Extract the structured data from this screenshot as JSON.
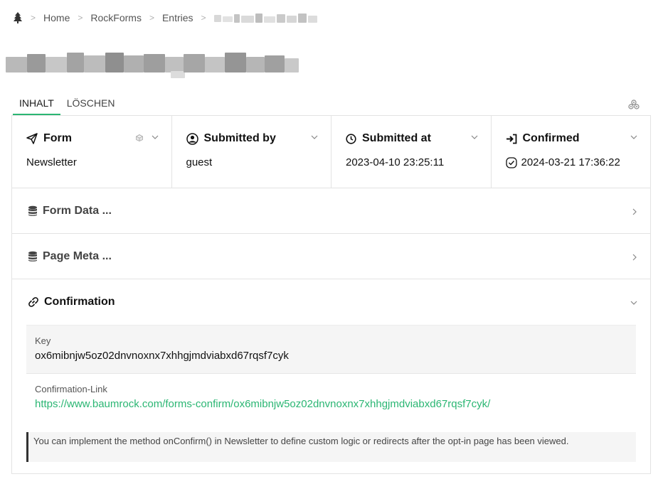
{
  "breadcrumb": {
    "items": [
      "Home",
      "RockForms",
      "Entries"
    ]
  },
  "tabs": [
    {
      "label": "INHALT",
      "active": true
    },
    {
      "label": "LÖSCHEN",
      "active": false
    }
  ],
  "summary": {
    "form": {
      "title": "Form",
      "value": "Newsletter"
    },
    "submitted_by": {
      "title": "Submitted by",
      "value": "guest"
    },
    "submitted_at": {
      "title": "Submitted at",
      "value": "2023-04-10 23:25:11"
    },
    "confirmed": {
      "title": "Confirmed",
      "value": "2024-03-21 17:36:22"
    }
  },
  "sections": {
    "form_data": {
      "title": "Form Data ..."
    },
    "page_meta": {
      "title": "Page Meta ..."
    },
    "confirmation": {
      "title": "Confirmation"
    }
  },
  "confirmation": {
    "key_label": "Key",
    "key_value": "ox6mibnjw5oz02dnvnoxnx7xhhgjmdviabxd67rqsf7cyk",
    "link_label": "Confirmation-Link",
    "link_value": "https://www.baumrock.com/forms-confirm/ox6mibnjw5oz02dnvnoxnx7xhhgjmdviabxd67rqsf7cyk/",
    "note": "You can implement the method onConfirm() in Newsletter to define custom logic or redirects after the opt-in page has been viewed."
  },
  "colors": {
    "accent": "#2bb673",
    "border": "#e3e3e3"
  },
  "icons": [
    "tree-icon",
    "settings-icon",
    "paper-plane-icon",
    "user-circle-icon",
    "clock-icon",
    "sign-in-icon",
    "check-circle-icon",
    "database-icon",
    "link-icon",
    "chevron-down-icon",
    "chevron-right-icon",
    "cube-icon"
  ]
}
